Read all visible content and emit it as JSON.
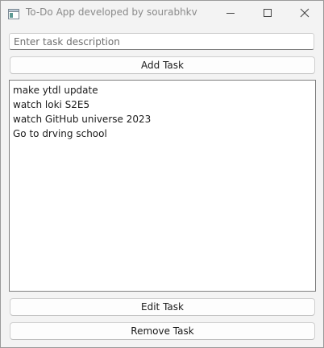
{
  "window": {
    "title": "To-Do App developed by sourabhkv",
    "icons": {
      "app": "app-window-icon",
      "minimize": "minimize-icon",
      "maximize": "maximize-icon",
      "close": "close-icon"
    }
  },
  "input": {
    "placeholder": "Enter task description",
    "value": ""
  },
  "buttons": {
    "add": "Add Task",
    "edit": "Edit Task",
    "remove": "Remove Task"
  },
  "tasks": [
    "make ytdl update",
    "watch loki S2E5",
    "watch GitHub universe 2023",
    "Go to drving school"
  ],
  "colors": {
    "window_bg": "#f3f3f3",
    "list_bg": "#ffffff",
    "text": "#1b1b1b",
    "title_text": "#8a8a8a"
  }
}
